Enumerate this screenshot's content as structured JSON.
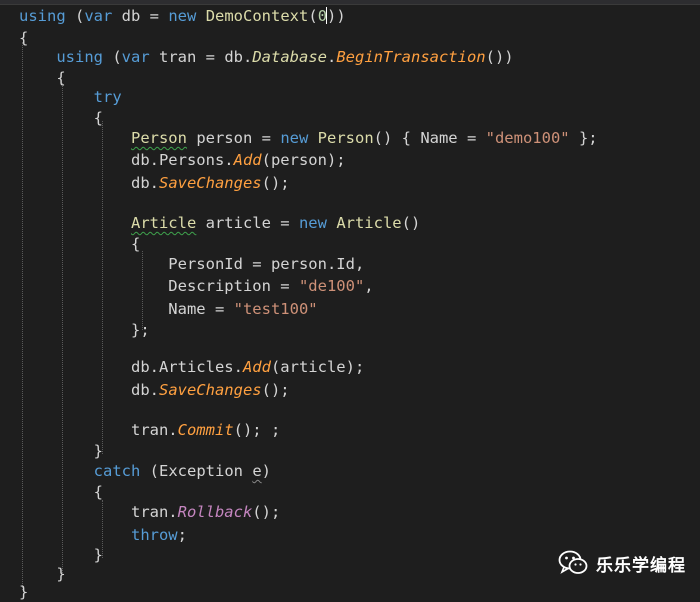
{
  "colors": {
    "background": "#1e1e1e",
    "keyword": "#569cd6",
    "type": "#dcdcaa",
    "method": "#ffa040",
    "method_purple": "#c586c0",
    "string": "#ce9178",
    "plain": "#d4d4d4",
    "number": "#b5cea8"
  },
  "watermark": {
    "icon": "wechat-icon",
    "text": "乐乐学编程"
  },
  "code_lines": [
    [
      {
        "t": "using",
        "c": "kw"
      },
      {
        "t": " (",
        "c": "p"
      },
      {
        "t": "var",
        "c": "kw"
      },
      {
        "t": " db = ",
        "c": "p"
      },
      {
        "t": "new",
        "c": "kw"
      },
      {
        "t": " ",
        "c": "p"
      },
      {
        "t": "DemoContext",
        "c": "ty"
      },
      {
        "t": "(",
        "c": "p"
      },
      {
        "t": "0",
        "c": "num"
      },
      {
        "t": "CURSOR",
        "c": "cursor"
      },
      {
        "t": "))",
        "c": "p"
      }
    ],
    [
      {
        "t": "{",
        "c": "p"
      }
    ],
    [
      {
        "t": "    ",
        "c": "p"
      },
      {
        "t": "using",
        "c": "kw"
      },
      {
        "t": " (",
        "c": "p"
      },
      {
        "t": "var",
        "c": "kw"
      },
      {
        "t": " tran = db.",
        "c": "p"
      },
      {
        "t": "Database",
        "c": "ty-i"
      },
      {
        "t": ".",
        "c": "p"
      },
      {
        "t": "BeginTransaction",
        "c": "me"
      },
      {
        "t": "())",
        "c": "p"
      }
    ],
    [
      {
        "t": "    {",
        "c": "p"
      }
    ],
    [
      {
        "t": "        ",
        "c": "p"
      },
      {
        "t": "try",
        "c": "kw"
      }
    ],
    [
      {
        "t": "        {",
        "c": "p"
      }
    ],
    [
      {
        "t": "            ",
        "c": "p"
      },
      {
        "t": "Person",
        "c": "ty-sq"
      },
      {
        "t": " person = ",
        "c": "p"
      },
      {
        "t": "new",
        "c": "kw"
      },
      {
        "t": " ",
        "c": "p"
      },
      {
        "t": "Person",
        "c": "ty"
      },
      {
        "t": "() { Name = ",
        "c": "p"
      },
      {
        "t": "\"demo100\"",
        "c": "str"
      },
      {
        "t": " };",
        "c": "p"
      }
    ],
    [
      {
        "t": "            db.Persons.",
        "c": "p"
      },
      {
        "t": "Add",
        "c": "me"
      },
      {
        "t": "(person);",
        "c": "p"
      }
    ],
    [
      {
        "t": "            db.",
        "c": "p"
      },
      {
        "t": "SaveChanges",
        "c": "me"
      },
      {
        "t": "();",
        "c": "p"
      }
    ],
    [],
    [
      {
        "t": "            ",
        "c": "p"
      },
      {
        "t": "Article",
        "c": "ty-sq"
      },
      {
        "t": " article = ",
        "c": "p"
      },
      {
        "t": "new",
        "c": "kw"
      },
      {
        "t": " ",
        "c": "p"
      },
      {
        "t": "Article",
        "c": "ty"
      },
      {
        "t": "()",
        "c": "p"
      }
    ],
    [
      {
        "t": "            {",
        "c": "p"
      }
    ],
    [
      {
        "t": "                PersonId = person.Id,",
        "c": "p"
      }
    ],
    [
      {
        "t": "                Description = ",
        "c": "p"
      },
      {
        "t": "\"de100\"",
        "c": "str"
      },
      {
        "t": ",",
        "c": "p"
      }
    ],
    [
      {
        "t": "                Name = ",
        "c": "p"
      },
      {
        "t": "\"test100\"",
        "c": "str"
      }
    ],
    [
      {
        "t": "            };",
        "c": "p"
      }
    ],
    [],
    [
      {
        "t": "            db.Articles.",
        "c": "p"
      },
      {
        "t": "Add",
        "c": "me"
      },
      {
        "t": "(article);",
        "c": "p"
      }
    ],
    [
      {
        "t": "            db.",
        "c": "p"
      },
      {
        "t": "SaveChanges",
        "c": "me"
      },
      {
        "t": "();",
        "c": "p"
      }
    ],
    [],
    [
      {
        "t": "            tran.",
        "c": "p"
      },
      {
        "t": "Commit",
        "c": "me"
      },
      {
        "t": "(); ;",
        "c": "p"
      }
    ],
    [
      {
        "t": "        }",
        "c": "p"
      }
    ],
    [
      {
        "t": "        ",
        "c": "p"
      },
      {
        "t": "catch",
        "c": "kw"
      },
      {
        "t": " (Exception ",
        "c": "p"
      },
      {
        "t": "e",
        "c": "p-sq"
      },
      {
        "t": ")",
        "c": "p"
      }
    ],
    [
      {
        "t": "        {",
        "c": "p"
      }
    ],
    [
      {
        "t": "            tran.",
        "c": "p"
      },
      {
        "t": "Rollback",
        "c": "me-p"
      },
      {
        "t": "();",
        "c": "p"
      }
    ],
    [
      {
        "t": "            ",
        "c": "p"
      },
      {
        "t": "throw",
        "c": "kw"
      },
      {
        "t": ";",
        "c": "p"
      }
    ],
    [
      {
        "t": "        }",
        "c": "p"
      }
    ],
    [
      {
        "t": "    }",
        "c": "p"
      }
    ],
    [
      {
        "t": "}",
        "c": "p"
      }
    ]
  ]
}
